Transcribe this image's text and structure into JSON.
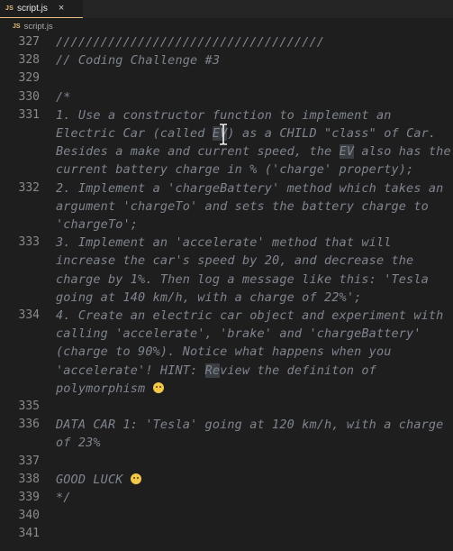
{
  "tab": {
    "badge": "JS",
    "filename": "script.js",
    "close": "×"
  },
  "breadcrumb": {
    "badge": "JS",
    "filename": "script.js"
  },
  "lines": [
    {
      "number": "327",
      "text": "////////////////////////////////////"
    },
    {
      "number": "328",
      "text": "// Coding Challenge #3"
    },
    {
      "number": "329",
      "text": ""
    },
    {
      "number": "330",
      "text": "/*"
    },
    {
      "number": "331",
      "text": "1. Use a constructor function to implement an"
    },
    {
      "number": "",
      "text_before_hl": "Electric Car (called ",
      "hl": "EV",
      "text_after_hl": ") as a CHILD \"class\" of Car."
    },
    {
      "number": "",
      "text_before_hl": "Besides a make and current speed, the ",
      "hl": "EV",
      "text_after_hl": " also has the"
    },
    {
      "number": "",
      "text": "current battery charge in % ('charge' property);"
    },
    {
      "number": "332",
      "text": "2. Implement a 'chargeBattery' method which takes an"
    },
    {
      "number": "",
      "text": "argument 'chargeTo' and sets the battery charge to"
    },
    {
      "number": "",
      "text": "'chargeTo';"
    },
    {
      "number": "333",
      "text": "3. Implement an 'accelerate' method that will"
    },
    {
      "number": "",
      "text": "increase the car's speed by 20, and decrease the"
    },
    {
      "number": "",
      "text": "charge by 1%. Then log a message like this: 'Tesla"
    },
    {
      "number": "",
      "text": "going at 140 km/h, with a charge of 22%';"
    },
    {
      "number": "334",
      "text": "4. Create an electric car object and experiment with"
    },
    {
      "number": "",
      "text": "calling 'accelerate', 'brake' and 'chargeBattery'"
    },
    {
      "number": "",
      "text": "(charge to 90%). Notice what happens when you"
    },
    {
      "number": "",
      "text_before_hl": "'accelerate'! HINT: ",
      "hl": "Re",
      "text_after_hl": "view the definiton of"
    },
    {
      "number": "",
      "text": "polymorphism ",
      "emoji": "😉"
    },
    {
      "number": "335",
      "text": ""
    },
    {
      "number": "336",
      "text": "DATA CAR 1: 'Tesla' going at 120 km/h, with a charge"
    },
    {
      "number": "",
      "text": "of 23%"
    },
    {
      "number": "337",
      "text": ""
    },
    {
      "number": "338",
      "text": "GOOD LUCK ",
      "emoji": "😉"
    },
    {
      "number": "339",
      "text": "*/"
    },
    {
      "number": "340",
      "text": ""
    },
    {
      "number": "341",
      "text": ""
    }
  ]
}
